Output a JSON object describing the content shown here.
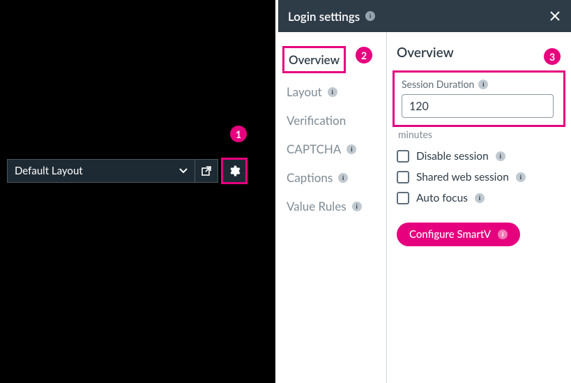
{
  "colors": {
    "accent": "#e6007e",
    "panel": "#2e3c48"
  },
  "callouts": {
    "one": "1",
    "two": "2",
    "three": "3"
  },
  "layoutbar": {
    "selected": "Default Layout"
  },
  "modal": {
    "title": "Login settings",
    "tabs": {
      "overview": "Overview",
      "layout": "Layout",
      "verification": "Verification",
      "captcha": "CAPTCHA",
      "captions": "Captions",
      "value_rules": "Value Rules"
    },
    "content": {
      "heading": "Overview",
      "session_label": "Session Duration",
      "session_value": "120",
      "minutes": "minutes",
      "chk_disable": "Disable session",
      "chk_shared": "Shared web session",
      "chk_autofocus": "Auto focus",
      "configure_btn": "Configure SmartV"
    }
  }
}
